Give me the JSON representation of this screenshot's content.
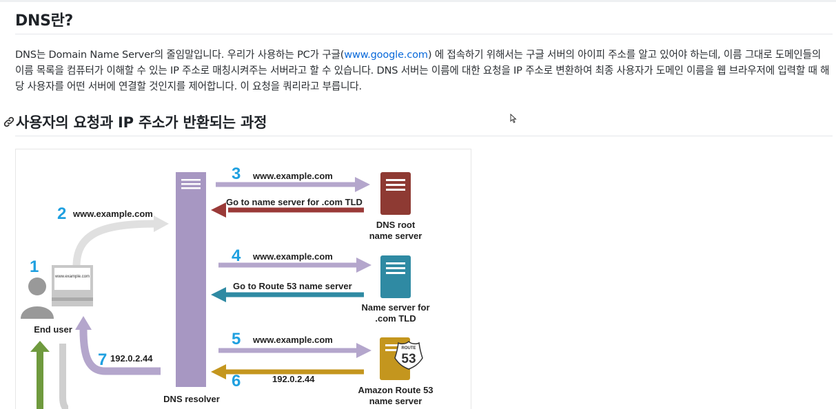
{
  "article": {
    "title": "DNS란?",
    "intro_before_link": "DNS는 Domain Name Server의 줄임말입니다. 우리가 사용하는 PC가 구글(",
    "intro_link": "www.google.com",
    "intro_after_link": ") 에 접속하기 위해서는 구글 서버의 아이피 주소를 알고 있어야 하는데, 이름 그대로 도메인들의 이름 목록을 컴퓨터가 이해할 수 있는 IP 주소로 매칭시켜주는 서버라고 할 수 있습니다. DNS 서버는 이름에 대한 요청을 IP 주소로 변환하여 최종 사용자가 도메인 이름을 웹 브라우저에 입력할 때 해당 사용자를 어떤 서버에 연결할 것인지를 제어합니다. 이 요청을 쿼리라고 부릅니다.",
    "section_heading": "사용자의 요청과 IP 주소가 반환되는 과정"
  },
  "diagram": {
    "screen_text": "www.example.com",
    "end_user": "End user",
    "resolver": "DNS resolver",
    "step1": "1",
    "step2": "2",
    "step2_label": "www.example.com",
    "step3": "3",
    "step3_label": "www.example.com",
    "root_reply": "Go to name server for .com TLD",
    "root_name_1": "DNS root",
    "root_name_2": "name server",
    "step4": "4",
    "step4_label": "www.example.com",
    "tld_reply": "Go to Route 53 name server",
    "tld_name_1": "Name server for",
    "tld_name_2": ".com TLD",
    "step5": "5",
    "step5_label": "www.example.com",
    "step6": "6",
    "step6_label": "192.0.2.44",
    "route_badge_top": "ROUTE",
    "route_badge_num": "53",
    "r53_name_1": "Amazon Route 53",
    "r53_name_2": "name server",
    "step7": "7",
    "step7_label": "192.0.2.44"
  },
  "colors": {
    "link": "#0969da",
    "step_number": "#1fa0e0",
    "resolver": "#a797c2",
    "root_server": "#8e3a33",
    "tld_server": "#2f8aa3",
    "route53_server": "#c4961e",
    "reply_root": "#9a3a38",
    "reply_tld": "#2f8aa3",
    "reply_r53": "#c4961e",
    "query_arrow": "#b4a6cc",
    "user_green": "#6f9a3e"
  }
}
